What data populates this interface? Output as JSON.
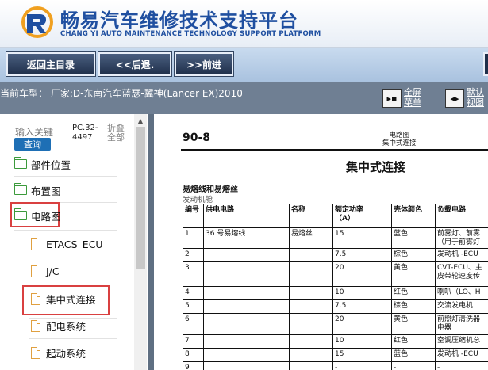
{
  "header": {
    "title": "畅易汽车维修技术支持平台",
    "subtitle": "CHANG YI AUTO MAINTENANCE TECHNOLOGY SUPPORT PLATFORM",
    "brand_color": "#1f4fa0"
  },
  "nav": {
    "home": "返回主目录",
    "back": "<<后退.",
    "forward": ">>前进"
  },
  "info": {
    "car_model": "当前车型：  厂家:D-东南汽车蓝瑟-翼神(Lancer EX)2010",
    "fullscreen_line1": "全屏",
    "fullscreen_line2": "菜单",
    "default_line1": "默认",
    "default_line2": "视图"
  },
  "sidebar": {
    "search_placeholder": "输入关键",
    "query_button": "查询",
    "pc_code_line1": "PC.32-",
    "pc_code_line2": "4497",
    "collapse_line1": "折叠",
    "collapse_line2": "全部",
    "items": [
      {
        "label": "部件位置"
      },
      {
        "label": "布置图"
      },
      {
        "label": "电路图"
      },
      {
        "label": "ETACS_ECU"
      },
      {
        "label": "J/C"
      },
      {
        "label": "集中式连接"
      },
      {
        "label": "配电系统"
      },
      {
        "label": "起动系统"
      }
    ],
    "highlight_color": "#d94040"
  },
  "document": {
    "page_number": "90-8",
    "section_line1": "电路图",
    "section_line2": "集中式连接",
    "title": "集中式连接",
    "table_title": "易熔线和易熔丝",
    "table_subtitle": "发动机舱",
    "columns": [
      "编号",
      "供电电路",
      "名称",
      "额定功率",
      "壳体颜色",
      "负载电路"
    ],
    "rated_unit": "（A）",
    "rows": [
      {
        "no": "1",
        "circuit": "36 号易熔线",
        "name": "易熔丝",
        "rating": "15",
        "color": "蓝色",
        "load1": "前雾灯、前雾",
        "load2": "（用于前雾灯"
      },
      {
        "no": "2",
        "circuit": "",
        "name": "",
        "rating": "7.5",
        "color": "棕色",
        "load1": "发动机 -ECU",
        "load2": ""
      },
      {
        "no": "3",
        "circuit": "",
        "name": "",
        "rating": "20",
        "color": "黄色",
        "load1": "CVT-ECU、主",
        "load2": "皮带轮速度传"
      },
      {
        "no": "4",
        "circuit": "",
        "name": "",
        "rating": "10",
        "color": "红色",
        "load1": "喇叭（LO、H",
        "load2": ""
      },
      {
        "no": "5",
        "circuit": "",
        "name": "",
        "rating": "7.5",
        "color": "棕色",
        "load1": "交流发电机",
        "load2": ""
      },
      {
        "no": "6",
        "circuit": "",
        "name": "",
        "rating": "20",
        "color": "黄色",
        "load1": "前照灯清洗器",
        "load2": "电器"
      },
      {
        "no": "7",
        "circuit": "",
        "name": "",
        "rating": "10",
        "color": "红色",
        "load1": "空调压缩机总",
        "load2": ""
      },
      {
        "no": "8",
        "circuit": "",
        "name": "",
        "rating": "15",
        "color": "蓝色",
        "load1": "发动机 -ECU",
        "load2": ""
      },
      {
        "no": "9",
        "circuit": "",
        "name": "",
        "rating": "-",
        "color": "-",
        "load1": "-",
        "load2": ""
      }
    ]
  }
}
